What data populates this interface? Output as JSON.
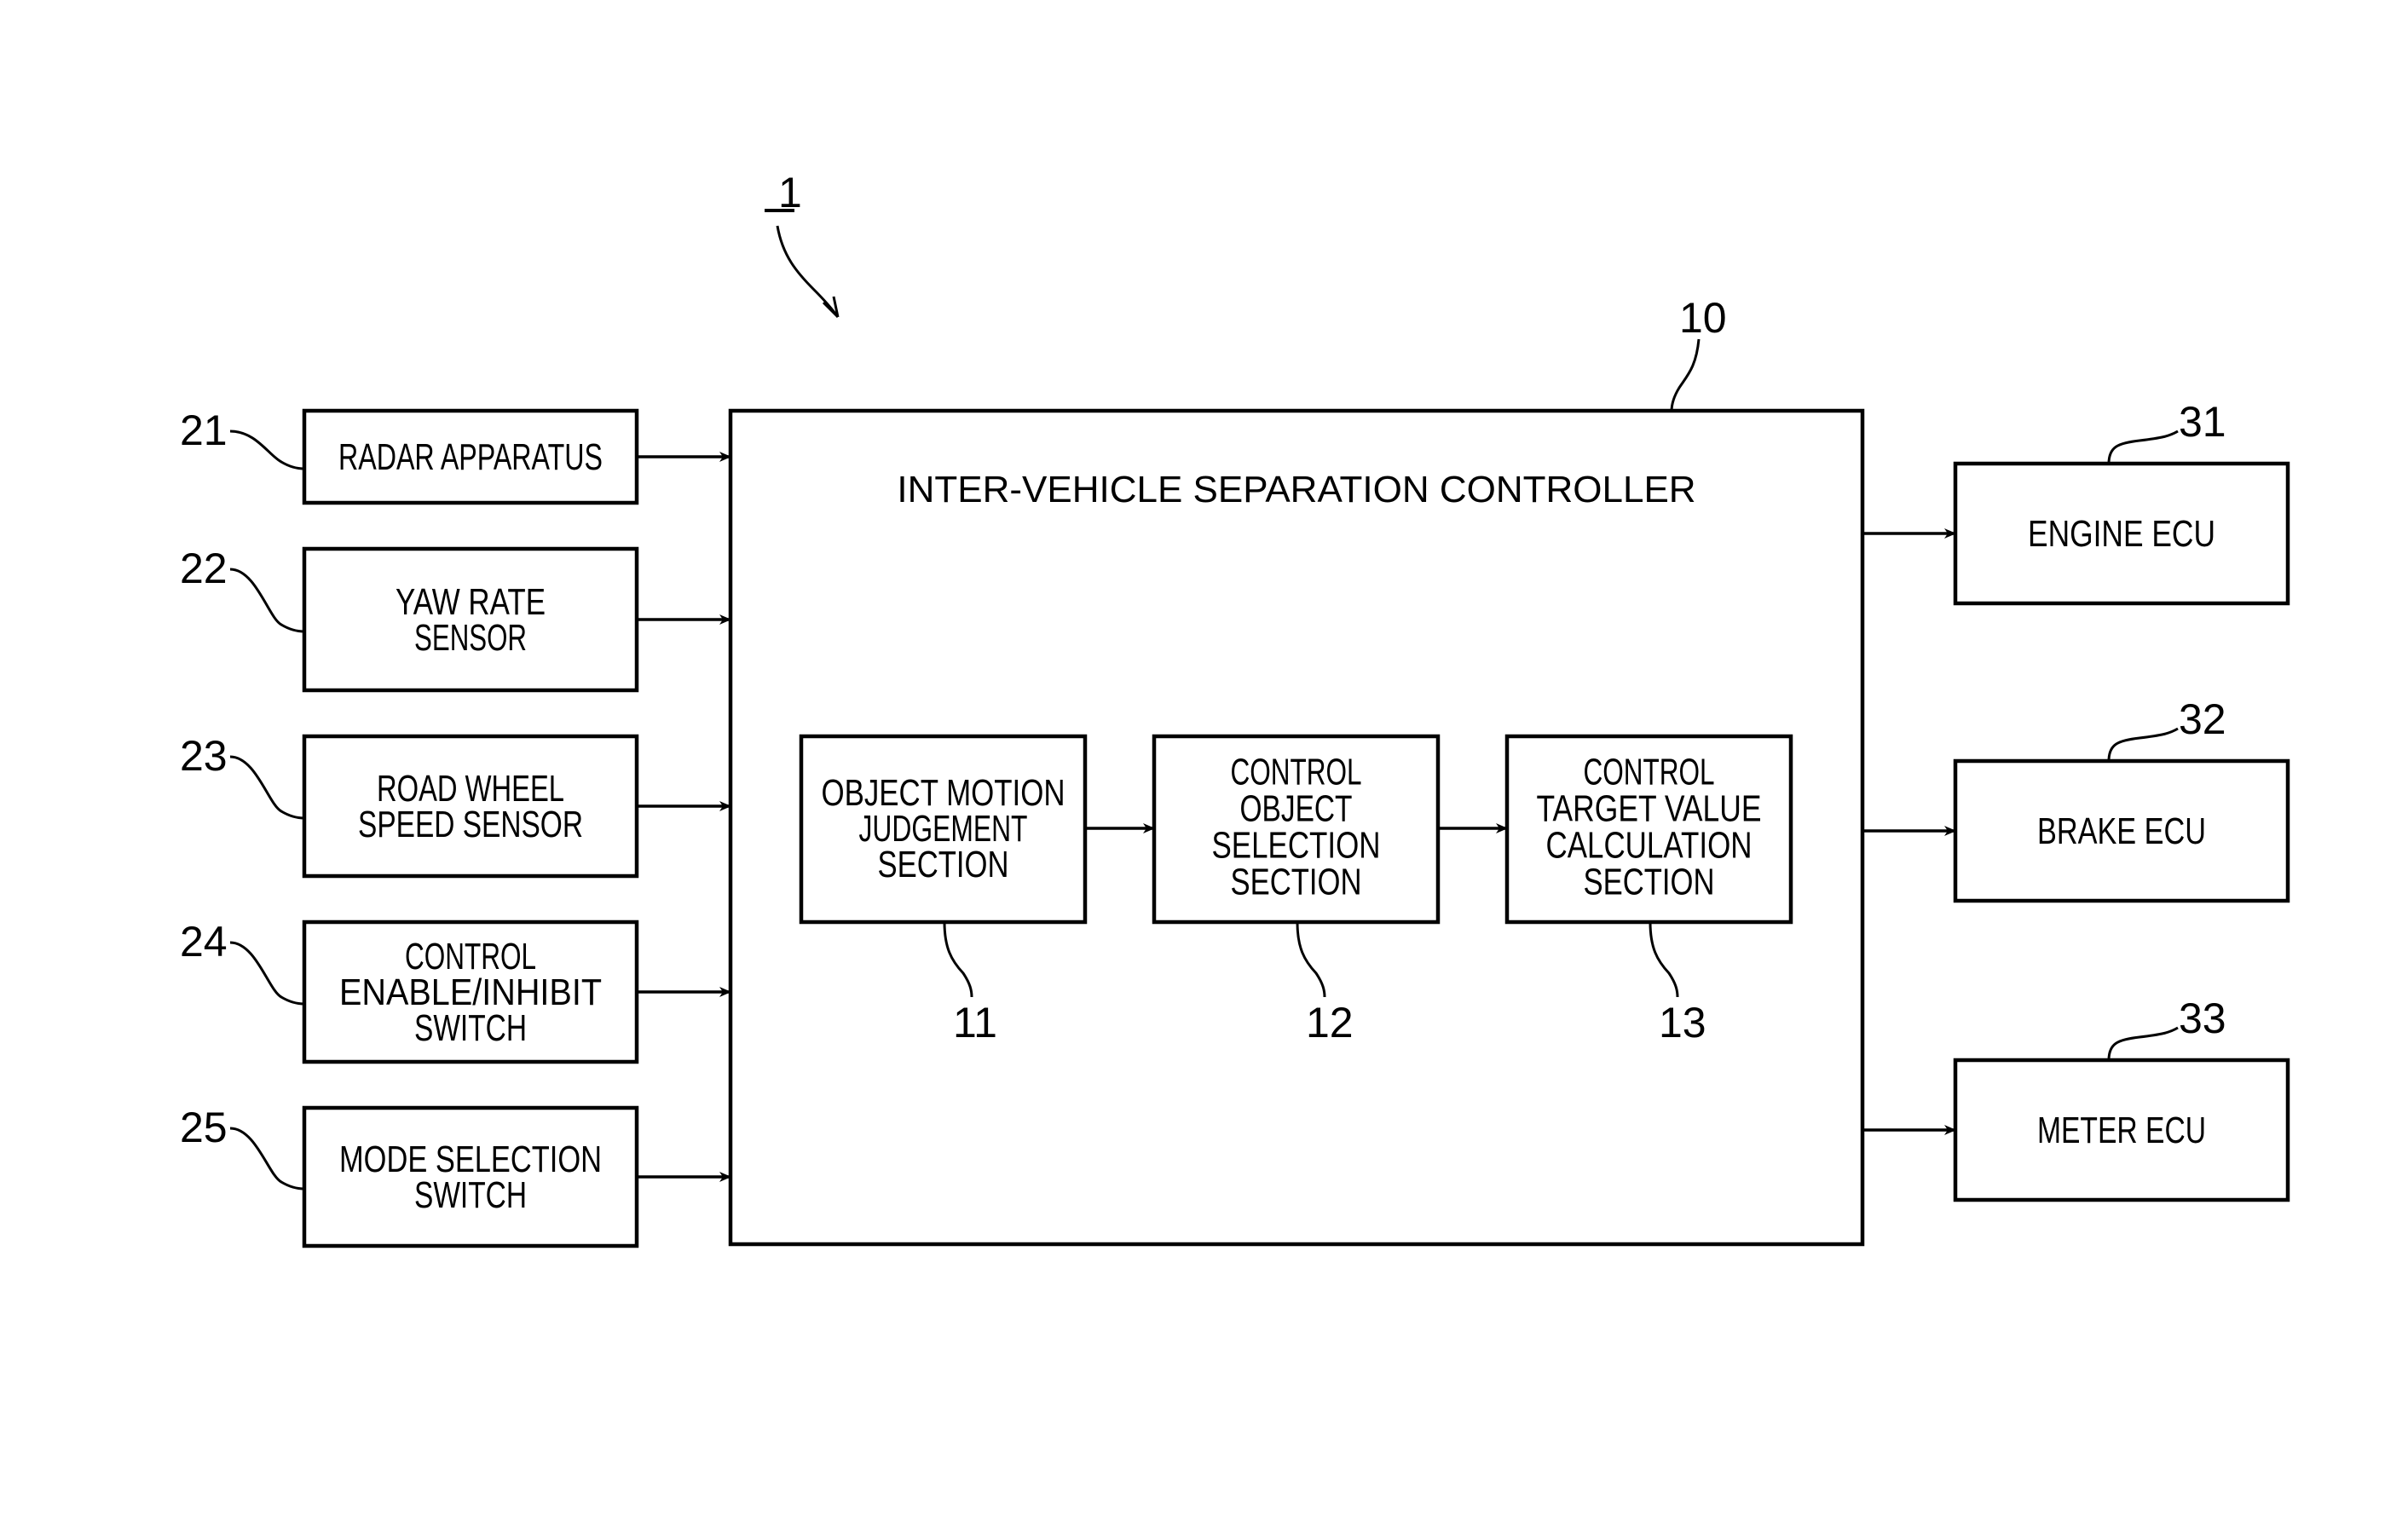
{
  "figure": {
    "system_ref": "1",
    "controller": {
      "ref": "10",
      "title": "INTER-VEHICLE SEPARATION CONTROLLER",
      "sections": [
        {
          "ref": "11",
          "lines": [
            "OBJECT MOTION",
            "JUDGEMENT",
            "SECTION"
          ]
        },
        {
          "ref": "12",
          "lines": [
            "CONTROL",
            "OBJECT",
            "SELECTION",
            "SECTION"
          ]
        },
        {
          "ref": "13",
          "lines": [
            "CONTROL",
            "TARGET VALUE",
            "CALCULATION",
            "SECTION"
          ]
        }
      ]
    },
    "inputs": [
      {
        "ref": "21",
        "lines": [
          "RADAR APPARATUS"
        ]
      },
      {
        "ref": "22",
        "lines": [
          "YAW RATE",
          "SENSOR"
        ]
      },
      {
        "ref": "23",
        "lines": [
          "ROAD WHEEL",
          "SPEED SENSOR"
        ]
      },
      {
        "ref": "24",
        "lines": [
          "CONTROL",
          "ENABLE/INHIBIT",
          "SWITCH"
        ]
      },
      {
        "ref": "25",
        "lines": [
          "MODE SELECTION",
          "SWITCH"
        ]
      }
    ],
    "outputs": [
      {
        "ref": "31",
        "lines": [
          "ENGINE ECU"
        ]
      },
      {
        "ref": "32",
        "lines": [
          "BRAKE ECU"
        ]
      },
      {
        "ref": "33",
        "lines": [
          "METER ECU"
        ]
      }
    ]
  }
}
